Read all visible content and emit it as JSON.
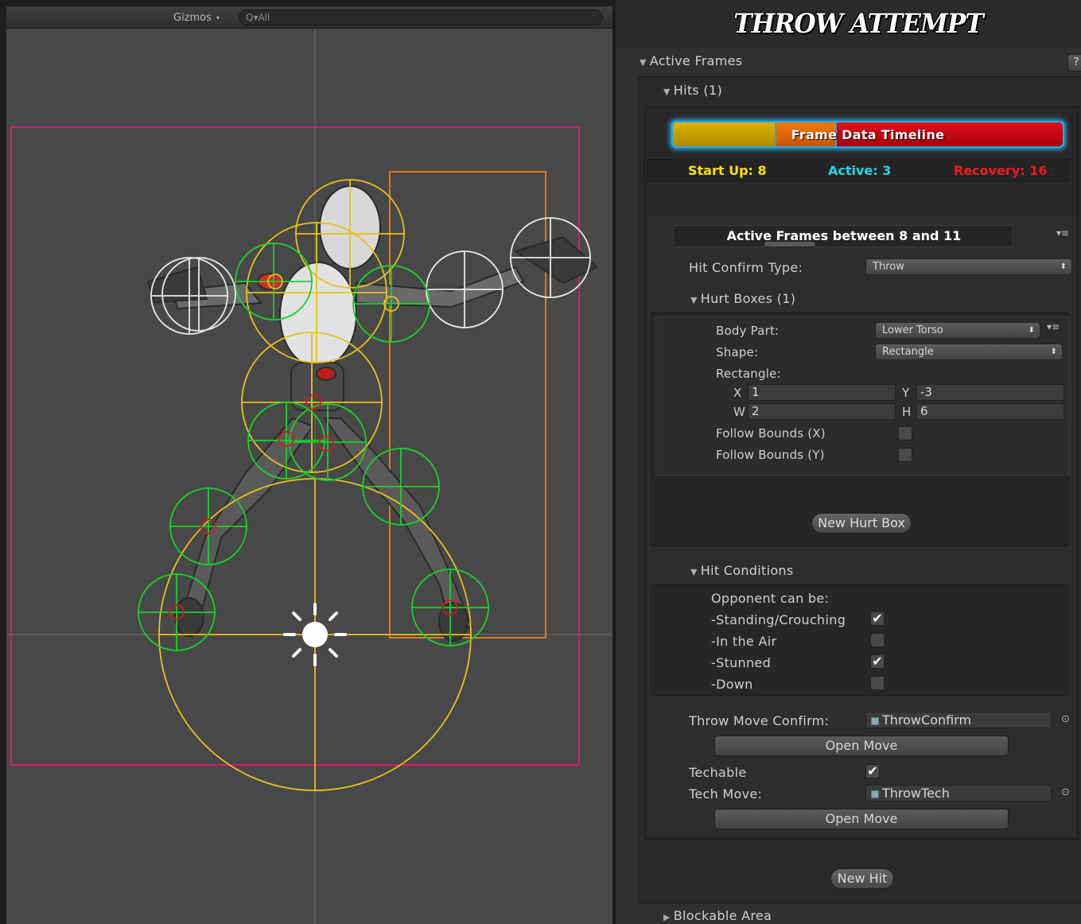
{
  "scene": {
    "gizmos_label": "Gizmos",
    "gizmos_caret": "▾",
    "search_placeholder": "Q▾All"
  },
  "inspector": {
    "title": "THROW ATTEMPT",
    "active_frames_label": "Active Frames",
    "help_label": "?",
    "hits_label": "Hits (1)",
    "timeline": {
      "label": "Frame Data Timeline",
      "startup_color": "#d9b400",
      "active_color": "#f07a10",
      "recovery_color": "#e0101a",
      "glow_color": "#2aa8e0"
    },
    "stats": {
      "startup": "Start Up: 8",
      "active": "Active: 3",
      "recovery": "Recovery: 16",
      "startup_color": "#ffe000",
      "active_color": "#21d6e6",
      "recovery_color": "#ee1c1c"
    },
    "active_range_label": "Active Frames between 8 and 11",
    "hit_confirm_type_label": "Hit Confirm Type:",
    "hit_confirm_type_value": "Throw",
    "hurt_boxes_label": "Hurt Boxes (1)",
    "hurt_box": {
      "body_part_label": "Body Part:",
      "body_part_value": "Lower Torso",
      "shape_label": "Shape:",
      "shape_value": "Rectangle",
      "rectangle_label": "Rectangle:",
      "x_label": "X",
      "x_value": "1",
      "y_label": "Y",
      "y_value": "-3",
      "w_label": "W",
      "w_value": "2",
      "h_label": "H",
      "h_value": "6",
      "follow_x_label": "Follow Bounds (X)",
      "follow_x_checked": false,
      "follow_y_label": "Follow Bounds (Y)",
      "follow_y_checked": false
    },
    "new_hurt_box_label": "New Hurt Box",
    "hit_conditions_label": "Hit Conditions",
    "opponent_label": "Opponent can be:",
    "conditions": [
      {
        "label": "-Standing/Crouching",
        "checked": true
      },
      {
        "label": "-In the Air",
        "checked": false
      },
      {
        "label": "-Stunned",
        "checked": true
      },
      {
        "label": "-Down",
        "checked": false
      }
    ],
    "throw_move_confirm_label": "Throw Move Confirm:",
    "throw_move_confirm_value": "ThrowConfirm",
    "open_move_label": "Open Move",
    "techable_label": "Techable",
    "techable_checked": true,
    "tech_move_label": "Tech Move:",
    "tech_move_value": "ThrowTech",
    "new_hit_label": "New Hit",
    "blockable_area_label": "Blockable Area",
    "check_glyph": "✔",
    "popup_arrows": "⬍",
    "menu_glyph": "▾≡",
    "picker_glyph": "⊙",
    "tri_open": "▼",
    "tri_closed": "▶"
  }
}
